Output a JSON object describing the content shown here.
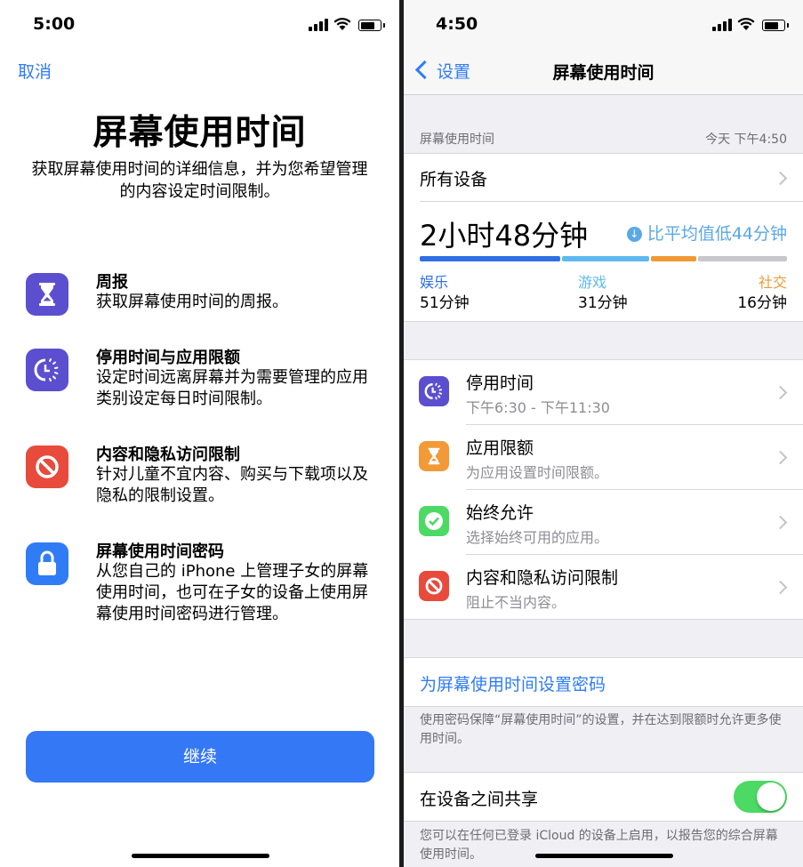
{
  "colors": {
    "accent": "#2f7cf6",
    "purple": "#5b4fcf",
    "orange": "#f19a37",
    "green": "#4cd964",
    "red": "#e84a3c",
    "blue_icon": "#2f7cf6",
    "bar_entertainment": "#2f6fe4",
    "bar_games": "#5fb9f0",
    "bar_social": "#ef9a34",
    "bar_rest": "#c7c7cc"
  },
  "left": {
    "status_time": "5:00",
    "cancel": "取消",
    "title": "屏幕使用时间",
    "subtitle": "获取屏幕使用时间的详细信息，并为您希望管理的内容设定时间限制。",
    "features": [
      {
        "icon": "hourglass-icon",
        "title": "周报",
        "desc": "获取屏幕使用时间的周报。"
      },
      {
        "icon": "downtime-icon",
        "title": "停用时间与应用限额",
        "desc": "设定时间远离屏幕并为需要管理的应用类别设定每日时间限制。"
      },
      {
        "icon": "restriction-icon",
        "title": "内容和隐私访问限制",
        "desc": "针对儿童不宜内容、购买与下载项以及隐私的限制设置。"
      },
      {
        "icon": "lock-icon",
        "title": "屏幕使用时间密码",
        "desc": "从您自己的 iPhone 上管理子女的屏幕使用时间，也可在子女的设备上使用屏幕使用时间密码进行管理。"
      }
    ],
    "continue": "继续"
  },
  "right": {
    "status_time": "4:50",
    "back": "设置",
    "nav_title": "屏幕使用时间",
    "section_title": "屏幕使用时间",
    "section_time": "今天 下午4:50",
    "all_devices": "所有设备",
    "total": "2小时48分钟",
    "compare": "比平均值低44分钟",
    "categories": [
      {
        "name": "娱乐",
        "value": "51分钟",
        "minutes": 51
      },
      {
        "name": "游戏",
        "value": "31分钟",
        "minutes": 31
      },
      {
        "name": "社交",
        "value": "16分钟",
        "minutes": 16
      }
    ],
    "rows": [
      {
        "icon": "downtime-icon",
        "title": "停用时间",
        "subtitle": "下午6:30 - 下午11:30"
      },
      {
        "icon": "hourglass-icon",
        "title": "应用限额",
        "subtitle": "为应用设置时间限额。"
      },
      {
        "icon": "checkmark-icon",
        "title": "始终允许",
        "subtitle": "选择始终可用的应用。"
      },
      {
        "icon": "restriction-icon",
        "title": "内容和隐私访问限制",
        "subtitle": "阻止不当内容。"
      }
    ],
    "passcode_link": "为屏幕使用时间设置密码",
    "passcode_note": "使用密码保障“屏幕使用时间”的设置，并在达到限额时允许更多使用时间。",
    "share_label": "在设备之间共享",
    "share_on": true,
    "share_note": "您可以在任何已登录 iCloud 的设备上启用，以报告您的综合屏幕使用时间。"
  }
}
